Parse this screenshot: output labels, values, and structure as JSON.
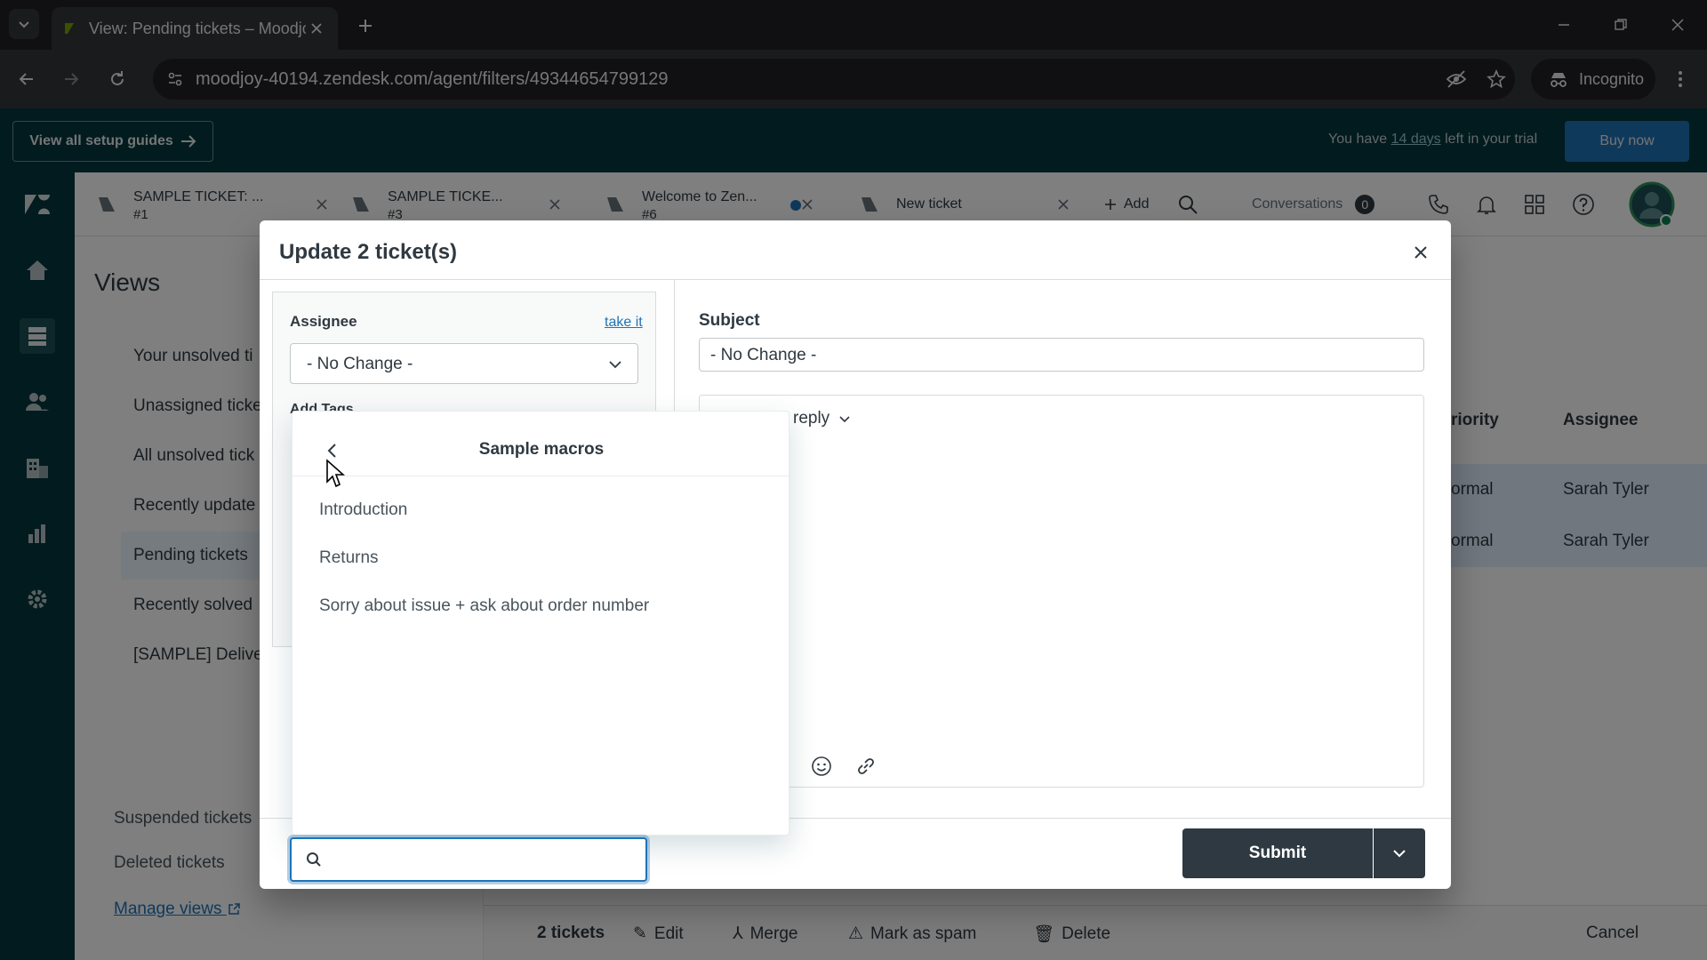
{
  "browser": {
    "tab_title": "View: Pending tickets – Moodjo",
    "url": "moodjoy-40194.zendesk.com/agent/filters/49344654799129",
    "incognito_label": "Incognito"
  },
  "trial_bar": {
    "guides_label": "View all setup guides",
    "trial_prefix": "You have",
    "trial_days": "14 days",
    "trial_suffix": "left in your trial",
    "buy_label": "Buy now"
  },
  "ticket_tabs": [
    {
      "title": "SAMPLE TICKET: ...",
      "number": "#1"
    },
    {
      "title": "SAMPLE TICKE...",
      "number": "#3"
    },
    {
      "title": "Welcome to Zen...",
      "number": "#6"
    },
    {
      "title": "New ticket",
      "number": ""
    }
  ],
  "topbar": {
    "add_label": "Add",
    "conversations_label": "Conversations",
    "conversations_count": "0"
  },
  "views": {
    "title": "Views",
    "items": [
      "Your unsolved ti",
      "Unassigned ticke",
      "All unsolved tick",
      "Recently update",
      "Pending tickets",
      "Recently solved",
      "[SAMPLE] Delive"
    ],
    "suspended": "Suspended tickets",
    "deleted": "Deleted tickets",
    "manage": "Manage views"
  },
  "table": {
    "col_priority": "riority",
    "col_assignee": "Assignee",
    "rows": [
      {
        "priority": "ormal",
        "assignee": "Sarah Tyler"
      },
      {
        "priority": "ormal",
        "assignee": "Sarah Tyler"
      }
    ]
  },
  "bulk_bar": {
    "count": "2 tickets",
    "edit": "Edit",
    "merge": "Merge",
    "spam": "Mark as spam",
    "delete": "Delete",
    "cancel": "Cancel"
  },
  "modal": {
    "title": "Update 2 ticket(s)",
    "assignee_label": "Assignee",
    "take_it": "take it",
    "assignee_value": "- No Change -",
    "add_tags_label": "Add Tags",
    "subject_label": "Subject",
    "subject_value": "- No Change -",
    "reply_type": "reply",
    "submit_label": "Submit"
  },
  "macro_menu": {
    "heading": "Sample macros",
    "items": [
      "Introduction",
      "Returns",
      "Sorry about issue + ask about order number"
    ],
    "search_placeholder": ""
  }
}
